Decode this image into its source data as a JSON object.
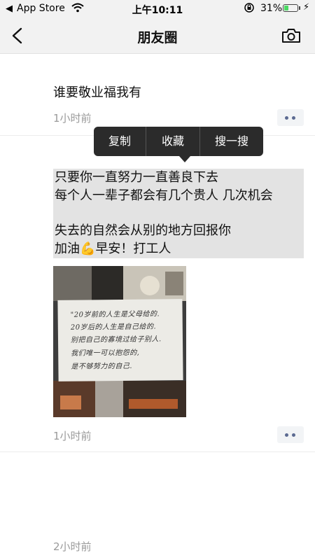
{
  "status_bar": {
    "back_app": "◀",
    "carrier": "App Store",
    "time": "上午10:11",
    "battery": "31%",
    "battery_level": 0.31
  },
  "nav": {
    "title": "朋友圈"
  },
  "posts": [
    {
      "text": "谁要敬业福我有",
      "time": "1小时前"
    },
    {
      "lines": [
        "只要你一直努力一直善良下去",
        "每个人一辈子都会有几个贵人 几次机会",
        "失去的自然会从别的地方回报你",
        "加油",
        "早安！打工人"
      ],
      "emoji": "💪",
      "image_text": [
        "\"20岁前的人生是父母给的.",
        "20岁后的人生是自己给的.",
        "别把自己的寡境过给子别人.",
        "我们唯一可以抱怨的,",
        "是不够努力的自己."
      ],
      "time": "1小时前"
    },
    {
      "time": "2小时前"
    }
  ],
  "context_menu": {
    "items": [
      "复制",
      "收藏",
      "搜一搜"
    ]
  },
  "colors": {
    "bar_bg": "#f2f2f2",
    "menu_bg": "#2b2b2b",
    "highlight": "#e3e3e3",
    "more_dots": "#5b6a91",
    "timestamp": "#9a9a9a"
  }
}
